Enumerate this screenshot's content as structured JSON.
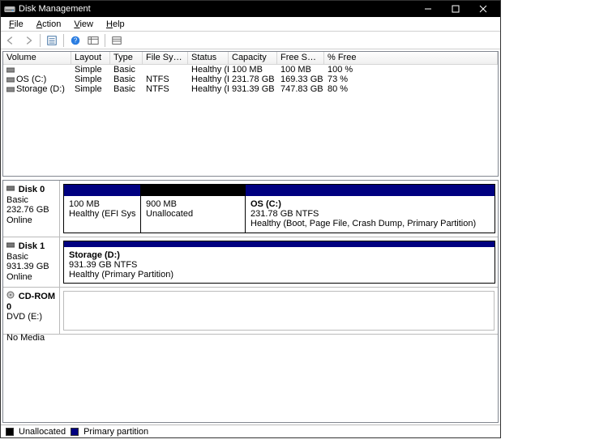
{
  "title": "Disk Management",
  "menu": {
    "file": "File",
    "action": "Action",
    "view": "View",
    "help": "Help"
  },
  "columns": {
    "volume": "Volume",
    "layout": "Layout",
    "type": "Type",
    "filesystem": "File System",
    "status": "Status",
    "capacity": "Capacity",
    "freespace": "Free Spa...",
    "pctfree": "% Free"
  },
  "rows": [
    {
      "volume": "",
      "layout": "Simple",
      "type": "Basic",
      "fs": "",
      "status": "Healthy (E...",
      "cap": "100 MB",
      "free": "100 MB",
      "pct": "100 %"
    },
    {
      "volume": "OS (C:)",
      "layout": "Simple",
      "type": "Basic",
      "fs": "NTFS",
      "status": "Healthy (B...",
      "cap": "231.78 GB",
      "free": "169.33 GB",
      "pct": "73 %"
    },
    {
      "volume": "Storage (D:)",
      "layout": "Simple",
      "type": "Basic",
      "fs": "NTFS",
      "status": "Healthy (P...",
      "cap": "931.39 GB",
      "free": "747.83 GB",
      "pct": "80 %"
    }
  ],
  "disks": {
    "d0": {
      "name": "Disk 0",
      "type": "Basic",
      "size": "232.76 GB",
      "state": "Online",
      "p0": {
        "size": "100 MB",
        "status": "Healthy (EFI System Part"
      },
      "p1": {
        "size": "900 MB",
        "status": "Unallocated"
      },
      "p2": {
        "title": "OS  (C:)",
        "size": "231.78 GB NTFS",
        "status": "Healthy (Boot, Page File, Crash Dump, Primary Partition)"
      }
    },
    "d1": {
      "name": "Disk 1",
      "type": "Basic",
      "size": "931.39 GB",
      "state": "Online",
      "p0": {
        "title": "Storage  (D:)",
        "size": "931.39 GB NTFS",
        "status": "Healthy (Primary Partition)"
      }
    },
    "cd0": {
      "name": "CD-ROM 0",
      "sub": "DVD (E:)",
      "state": "No Media"
    }
  },
  "legend": {
    "unalloc": "Unallocated",
    "primary": "Primary partition"
  }
}
